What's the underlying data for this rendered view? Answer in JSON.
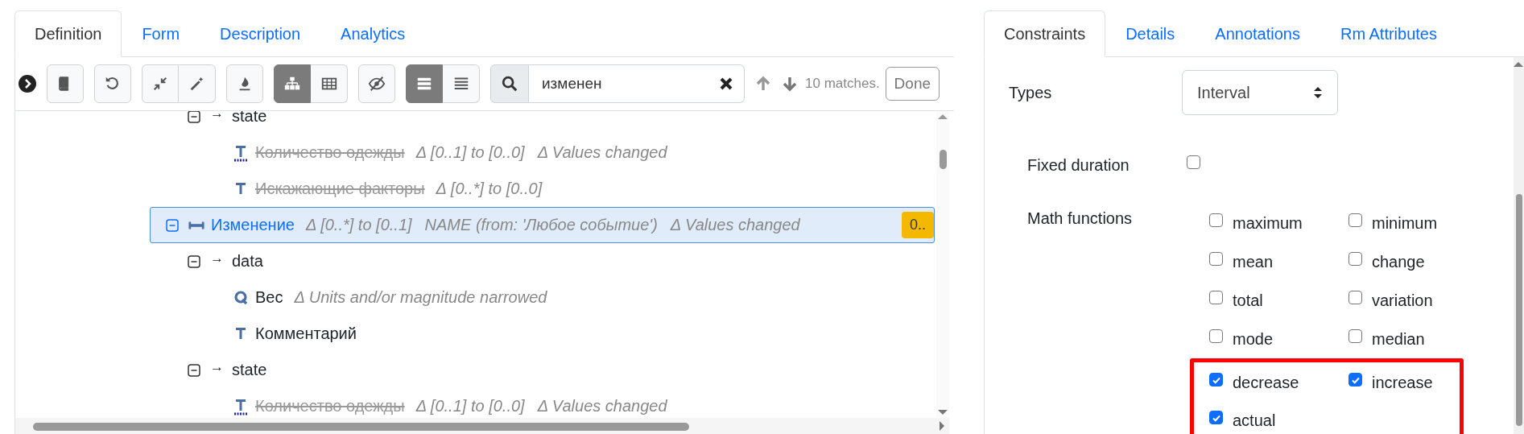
{
  "definition_panel": {
    "tabs": [
      {
        "label": "Definition",
        "selected": true
      },
      {
        "label": "Form",
        "selected": false
      },
      {
        "label": "Description",
        "selected": false
      },
      {
        "label": "Analytics",
        "selected": false
      }
    ],
    "toolbar": {
      "groups": [
        [
          {
            "kind": "book",
            "selected": false
          }
        ],
        [
          {
            "kind": "undo",
            "selected": false
          }
        ],
        [
          {
            "kind": "collapse",
            "selected": false
          },
          {
            "kind": "wand",
            "selected": false
          }
        ],
        [
          {
            "kind": "flame",
            "selected": false
          }
        ],
        [
          {
            "kind": "tree",
            "selected": true
          },
          {
            "kind": "table",
            "selected": false
          }
        ],
        [
          {
            "kind": "eye-slash",
            "selected": false
          }
        ],
        [
          {
            "kind": "list",
            "selected": true
          },
          {
            "kind": "lines",
            "selected": false
          }
        ]
      ],
      "search": {
        "value": "изменен",
        "matches": "10 matches.",
        "done": "Done"
      }
    },
    "tree": {
      "items": [
        {
          "children": [
            {
              "label": "state",
              "prefix": "→",
              "expanded": true,
              "selected": false,
              "children": [
                {
                  "kind": "count",
                  "label": "Количество одежды",
                  "removed": true,
                  "selected": false,
                  "notes": [
                    "Δ [0..1] to [0..0]",
                    "Δ Values changed"
                  ]
                },
                {
                  "kind": "text",
                  "label": "Искажающие факторы",
                  "removed": true,
                  "selected": false,
                  "notes": [
                    "Δ [0..*] to [0..0]"
                  ]
                }
              ]
            }
          ]
        },
        {
          "kind": "interval",
          "label": "Изменение",
          "removed": false,
          "selected": true,
          "expanded": true,
          "notes": [
            "Δ [0..*] to [0..1]",
            "NAME (from: 'Любое событие')",
            "Δ Values changed"
          ],
          "badge": "0..",
          "children": [
            {
              "label": "data",
              "prefix": "→",
              "expanded": true,
              "selected": false,
              "children": [
                {
                  "kind": "quantity",
                  "label": "Вес",
                  "removed": false,
                  "selected": false,
                  "notes": [
                    "Δ Units and/or magnitude narrowed"
                  ]
                },
                {
                  "kind": "text",
                  "label": "Комментарий",
                  "removed": false,
                  "selected": false
                }
              ]
            },
            {
              "label": "state",
              "prefix": "→",
              "expanded": true,
              "selected": false,
              "children": [
                {
                  "kind": "count",
                  "label": "Количество одежды",
                  "removed": true,
                  "selected": false,
                  "notes": [
                    "Δ [0..1] to [0..0]",
                    "Δ Values changed"
                  ]
                }
              ]
            }
          ]
        }
      ]
    }
  },
  "constraints_panel": {
    "tabs": [
      {
        "label": "Constraints",
        "selected": true
      },
      {
        "label": "Details",
        "selected": false
      },
      {
        "label": "Annotations",
        "selected": false
      },
      {
        "label": "Rm Attributes",
        "selected": false
      }
    ],
    "types": {
      "label": "Types",
      "value": "Interval"
    },
    "fixed_duration": {
      "label": "Fixed duration",
      "checked": false
    },
    "math_functions": {
      "label": "Math functions",
      "options": [
        {
          "label": "maximum",
          "checked": false,
          "highlighted": false
        },
        {
          "label": "minimum",
          "checked": false,
          "highlighted": false
        },
        {
          "label": "mean",
          "checked": false,
          "highlighted": false
        },
        {
          "label": "change",
          "checked": false,
          "highlighted": false
        },
        {
          "label": "total",
          "checked": false,
          "highlighted": false
        },
        {
          "label": "variation",
          "checked": false,
          "highlighted": false
        },
        {
          "label": "mode",
          "checked": false,
          "highlighted": false
        },
        {
          "label": "median",
          "checked": false,
          "highlighted": false
        },
        {
          "label": "decrease",
          "checked": true,
          "highlighted": true
        },
        {
          "label": "increase",
          "checked": true,
          "highlighted": true
        },
        {
          "label": "actual",
          "checked": true,
          "highlighted": true
        }
      ]
    }
  }
}
